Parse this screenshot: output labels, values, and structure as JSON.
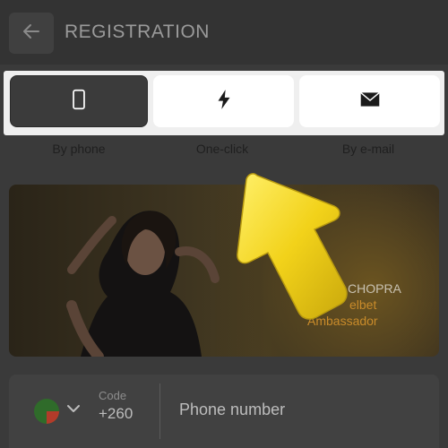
{
  "header": {
    "back_icon": "arrow-left-icon",
    "title": "REGISTRATION"
  },
  "tabs": [
    {
      "label": "By phone",
      "icon": "smartphone-icon",
      "active": true
    },
    {
      "label": "One-click",
      "icon": "lightning-icon",
      "active": false
    },
    {
      "label": "By e-mail",
      "icon": "envelope-icon",
      "active": false
    }
  ],
  "banner": {
    "ambassador_name": "CHOPRA",
    "brand_fragment": "elbet",
    "role": "Ambassador"
  },
  "phone": {
    "code_label": "Code",
    "code_value": "+260",
    "placeholder": "Phone number"
  },
  "colors": {
    "accent_yellow": "#f2d21a",
    "brand_orange": "#c98b2a"
  }
}
